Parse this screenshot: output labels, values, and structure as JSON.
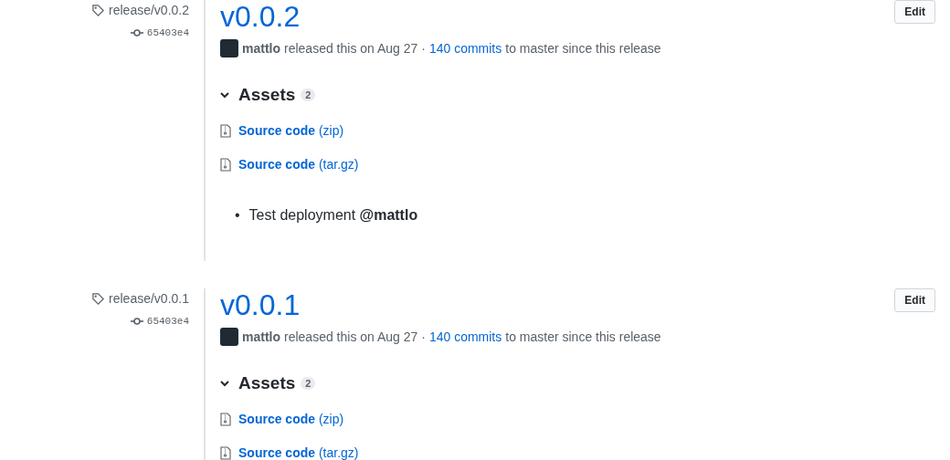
{
  "releases": [
    {
      "tag": "release/v0.0.2",
      "commit": "65403e4",
      "title": "v0.0.2",
      "edit_button": "Edit",
      "author": "mattlo",
      "released_text": "released this on Aug 27 ·",
      "commits_link": "140 commits",
      "commits_suffix": "to master since this release",
      "assets": {
        "label": "Assets",
        "count": "2",
        "expanded": true,
        "files": [
          {
            "name": "Source code",
            "format": "(zip)"
          },
          {
            "name": "Source code",
            "format": "(tar.gz)"
          }
        ]
      },
      "notes": [
        {
          "bullet": "•",
          "text": "Test deployment **@mattlo**"
        }
      ]
    },
    {
      "tag": "release/v0.0.1",
      "commit": "65403e4",
      "title": "v0.0.1",
      "edit_button": "Edit",
      "author": "mattlo",
      "released_text": "released this on Aug 27 ·",
      "commits_link": "140 commits",
      "commits_suffix": "to master since this release",
      "assets": {
        "label": "Assets",
        "count": "2",
        "expanded": true,
        "files": [
          {
            "name": "Source code",
            "format": "(zip)"
          },
          {
            "name": "Source code",
            "format": "(tar.gz)"
          }
        ]
      }
    }
  ]
}
